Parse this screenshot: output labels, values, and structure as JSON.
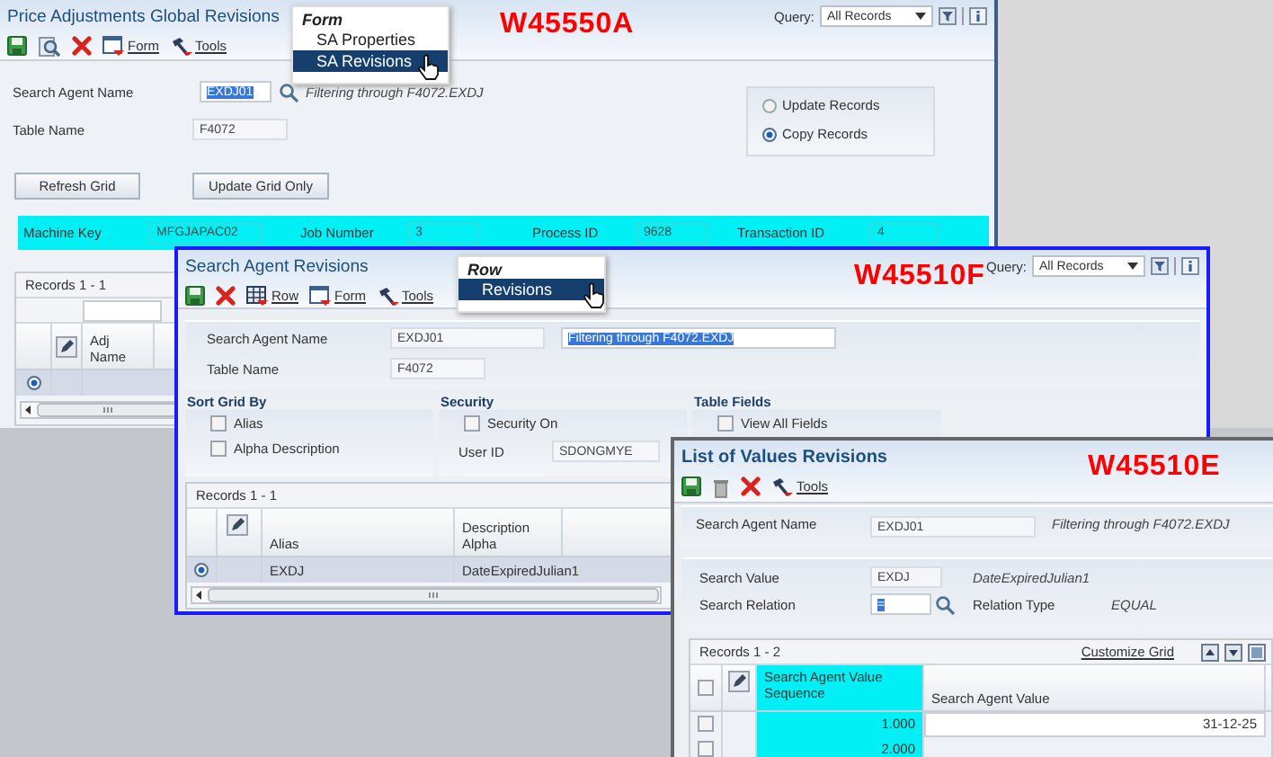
{
  "window_a": {
    "title": "Price Adjustments Global Revisions",
    "form_id": "W45550A",
    "menu": {
      "label": "Form",
      "items": [
        {
          "label": "SA Properties",
          "selected": false
        },
        {
          "label": "SA Revisions",
          "selected": true
        }
      ]
    },
    "toolbar": [
      "Form",
      "Tools"
    ],
    "query": {
      "label": "Query:",
      "value": "All Records"
    },
    "fields": [
      {
        "label": "Search Agent Name",
        "value": "EXDJ01",
        "note": "Filtering through F4072.EXDJ"
      },
      {
        "label": "Table Name",
        "value": "F4072"
      }
    ],
    "options": [
      {
        "label": "Update Records",
        "selected": false
      },
      {
        "label": "Copy Records",
        "selected": true
      }
    ],
    "buttons": [
      "Refresh Grid",
      "Update Grid Only"
    ],
    "info_bar": [
      {
        "label": "Machine Key",
        "value": "MFGJAPAC02"
      },
      {
        "label": "Job Number",
        "value": "3"
      },
      {
        "label": "Process ID",
        "value": "9628"
      },
      {
        "label": "Transaction ID",
        "value": "4"
      }
    ],
    "grid": {
      "records": "Records 1 - 1",
      "columns": [
        "Adj Name"
      ],
      "rows": [
        {
          "selected": true
        }
      ]
    }
  },
  "window_f": {
    "title": "Search Agent Revisions",
    "form_id": "W45510F",
    "menu": {
      "label": "Row",
      "items": [
        {
          "label": "Revisions",
          "selected": true
        }
      ]
    },
    "toolbar": [
      "Row",
      "Form",
      "Tools"
    ],
    "query": {
      "label": "Query:",
      "value": "All Records"
    },
    "fields": [
      {
        "label": "Search Agent Name",
        "value": "EXDJ01",
        "note": "Filtering through F4072.EXDJ"
      },
      {
        "label": "Table Name",
        "value": "F4072"
      }
    ],
    "sections": [
      {
        "title": "Sort Grid By",
        "checkboxes": [
          {
            "label": "Alias",
            "checked": false
          },
          {
            "label": "Alpha Description",
            "checked": false
          }
        ]
      },
      {
        "title": "Security",
        "checkboxes": [
          {
            "label": "Security On",
            "checked": false
          }
        ],
        "field": {
          "label": "User ID",
          "value": "SDONGMYE"
        }
      },
      {
        "title": "Table Fields",
        "checkboxes": [
          {
            "label": "View All Fields",
            "checked": false
          }
        ]
      }
    ],
    "grid": {
      "records": "Records 1 - 1",
      "columns": [
        "Alias",
        "Description Alpha"
      ],
      "rows": [
        {
          "selected": true,
          "cells": [
            "EXDJ",
            "DateExpiredJulian1"
          ]
        }
      ]
    }
  },
  "window_e": {
    "title": "List of Values Revisions",
    "form_id": "W45510E",
    "toolbar": [
      "Tools"
    ],
    "name_field": {
      "label": "Search Agent Name",
      "value": "EXDJ01",
      "note": "Filtering through F4072.EXDJ"
    },
    "search_value": {
      "label": "Search Value",
      "value": "EXDJ",
      "note": "DateExpiredJulian1"
    },
    "search_relation": {
      "label": "Search Relation",
      "value": "="
    },
    "relation_type": {
      "label": "Relation Type",
      "value": "EQUAL"
    },
    "grid": {
      "records": "Records 1 - 2",
      "customize": "Customize Grid",
      "select_all_checked": false,
      "columns": [
        "Search Agent Value Sequence",
        "Search Agent Value"
      ],
      "rows": [
        {
          "checked": false,
          "cells": [
            "1.000",
            "31-12-25"
          ]
        },
        {
          "checked": false,
          "cells": [
            "2.000"
          ]
        }
      ]
    }
  }
}
